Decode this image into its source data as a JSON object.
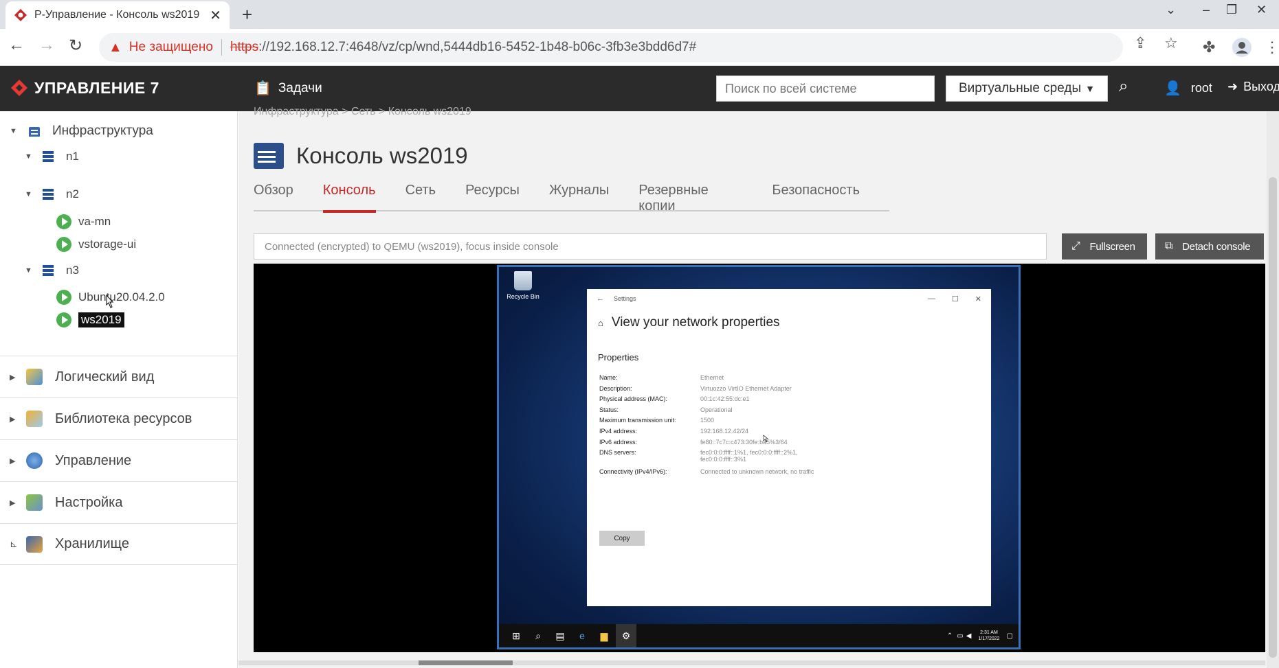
{
  "browser": {
    "tab_title": "Р-Управление - Консоль ws2019",
    "not_secure": "Не защищено",
    "url_scheme": "https",
    "url_rest": "://192.168.12.7:4648/vz/cp/wnd,5444db16-5452-1b48-b06c-3fb3e3bdd6d7#"
  },
  "header": {
    "logo_text": "УПРАВЛЕНИЕ 7",
    "tasks_label": "Задачи",
    "search_placeholder": "Поиск по всей системе",
    "env_select": "Виртуальные среды",
    "user": "root",
    "logout": "Выход"
  },
  "sidebar": {
    "root": "Инфраструктура",
    "nodes": [
      {
        "name": "n1",
        "vms": []
      },
      {
        "name": "n2",
        "vms": [
          "va-mn",
          "vstorage-ui"
        ]
      },
      {
        "name": "n3",
        "vms": [
          "Ubuntu20.04.2.0",
          "ws2019"
        ]
      }
    ],
    "sections": [
      "Логический вид",
      "Библиотека ресурсов",
      "Управление",
      "Настройка",
      "Хранилище"
    ]
  },
  "main": {
    "breadcrumb": "Инфраструктура  >  Сеть  >  Консоль ws2019",
    "title": "Консоль ws2019",
    "tabs": [
      "Обзор",
      "Консоль",
      "Сеть",
      "Ресурсы",
      "Журналы",
      "Резервные копии",
      "Безопасность"
    ],
    "active_tab": "Консоль",
    "status_text": "Connected (encrypted) to QEMU (ws2019), focus inside console",
    "fullscreen_label": "Fullscreen",
    "detach_label": "Detach console"
  },
  "guest": {
    "recycle_bin": "Recycle Bin",
    "window_title": "Settings",
    "heading": "View your network properties",
    "subheading": "Properties",
    "properties": [
      {
        "k": "Name:",
        "v": "Ethernet"
      },
      {
        "k": "Description:",
        "v": "Virtuozzo VirtIO Ethernet Adapter"
      },
      {
        "k": "Physical address (MAC):",
        "v": "00:1c:42:55:dc:e1"
      },
      {
        "k": "Status:",
        "v": "Operational"
      },
      {
        "k": "Maximum transmission unit:",
        "v": "1500"
      },
      {
        "k": "IPv4 address:",
        "v": "192.168.12.42/24"
      },
      {
        "k": "IPv6 address:",
        "v": "fe80::7c7c:c473:30fe:ba5%3/64"
      },
      {
        "k": "DNS servers:",
        "v": "fec0:0:0:ffff::1%1, fec0:0:0:ffff::2%1, fec0:0:0:ffff::3%1"
      },
      {
        "k": "Connectivity (IPv4/IPv6):",
        "v": "Connected to unknown network, no traffic"
      }
    ],
    "copy_label": "Copy",
    "clock_time": "2:31 AM",
    "clock_date": "1/17/2022"
  }
}
